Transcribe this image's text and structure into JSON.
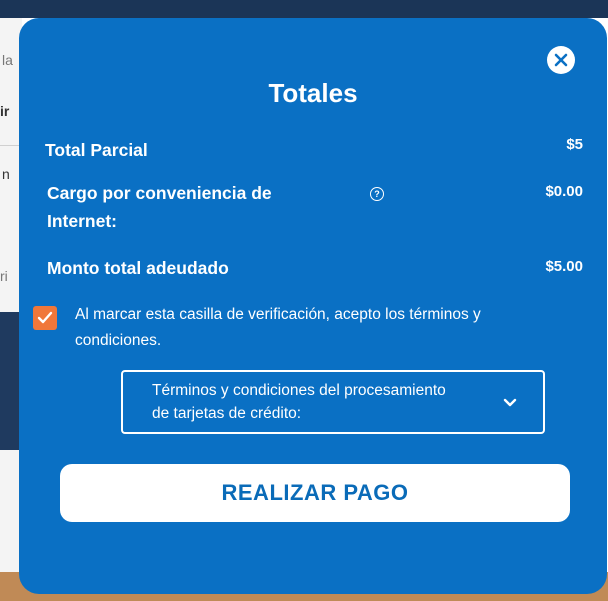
{
  "background": {
    "frag_la": "la",
    "frag_ir": "ir",
    "frag_n": "n",
    "frag_ri": "ri"
  },
  "modal": {
    "close_icon": "close-icon",
    "title": "Totales",
    "subtotal": {
      "label": "Total Parcial",
      "value": "$5"
    },
    "fee": {
      "label_line1": "Cargo por conveniencia de",
      "label_line2": "Internet:",
      "value": "$0.00",
      "icon": "help-circle-icon"
    },
    "total": {
      "label": "Monto total adeudado",
      "value": "$5.00"
    },
    "terms_checkbox": {
      "checked": true,
      "text_line1": "Al marcar esta casilla de verificación, acepto los términos y",
      "text_line2": "condiciones."
    },
    "dropdown": {
      "line1": "Términos y condiciones del procesamiento",
      "line2": "de tarjetas de crédito:",
      "icon": "chevron-down-icon"
    },
    "pay_button": "REALIZAR PAGO"
  },
  "colors": {
    "modal_bg": "#0a70c4",
    "checkbox": "#f0773a",
    "button_text": "#0a6bb8",
    "backdrop_top": "#1b3557"
  }
}
